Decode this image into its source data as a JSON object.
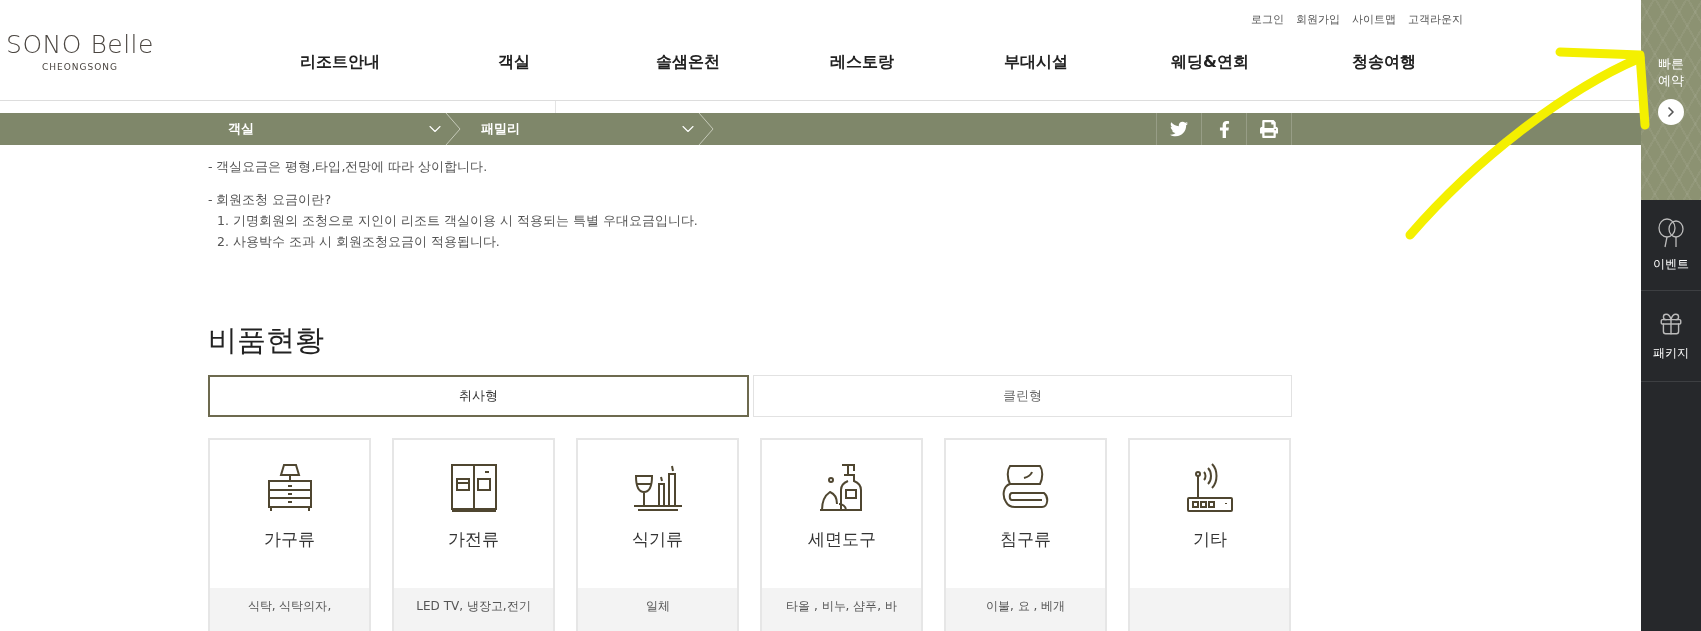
{
  "header": {
    "logo": {
      "name": "SONO Belle",
      "sub": "CHEONGSONG"
    },
    "utility_links": [
      "로그인",
      "회원가입",
      "사이트맵",
      "고객라운지"
    ],
    "nav": [
      "리조트안내",
      "객실",
      "솔샘온천",
      "레스토랑",
      "부대시설",
      "웨딩&연회",
      "청송여행"
    ]
  },
  "breadcrumb": [
    {
      "label": "객실"
    },
    {
      "label": "패밀리"
    }
  ],
  "notes": [
    {
      "kind": "bullet",
      "text": "- 객실요금은 평형,타입,전망에 따라 상이합니다."
    },
    {
      "kind": "bullet",
      "text": "- 회원조청 요금이란?"
    },
    {
      "kind": "numbered",
      "text": "1. 기명회원의 조청으로 지인이 리조트 객실이용 시 적용되는 특별 우대요금입니다."
    },
    {
      "kind": "numbered",
      "text": "2. 사용박수 조과 시 회원조청요금이 적용됩니다."
    }
  ],
  "section": {
    "title": "비품현황",
    "tabs": [
      {
        "label": "취사형",
        "selected": true
      },
      {
        "label": "클린형",
        "selected": false
      }
    ],
    "cards": [
      {
        "title": "가구류",
        "description": "식탁, 식탁의자,"
      },
      {
        "title": "가전류",
        "description": "LED TV, 냉장고,전기"
      },
      {
        "title": "식기류",
        "description": "일체"
      },
      {
        "title": "세면도구",
        "description": "타올 , 비누, 샴푸, 바"
      },
      {
        "title": "침구류",
        "description": "이불, 요 , 베개"
      },
      {
        "title": "기타"
      }
    ]
  },
  "sidebar": {
    "quick": {
      "label": "빠른 예약"
    },
    "items": [
      {
        "label": "이벤트"
      },
      {
        "label": "패키지"
      }
    ]
  }
}
